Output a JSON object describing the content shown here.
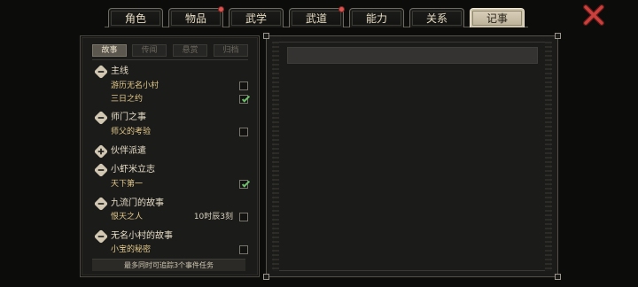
{
  "tabs": [
    {
      "label": "角色",
      "active": false,
      "badge": false
    },
    {
      "label": "物品",
      "active": false,
      "badge": true
    },
    {
      "label": "武学",
      "active": false,
      "badge": false
    },
    {
      "label": "武道",
      "active": false,
      "badge": true
    },
    {
      "label": "能力",
      "active": false,
      "badge": false
    },
    {
      "label": "关系",
      "active": false,
      "badge": false
    },
    {
      "label": "记事",
      "active": true,
      "badge": false
    }
  ],
  "close_icon": "close-x-icon",
  "subtabs": [
    {
      "label": "故事",
      "active": true
    },
    {
      "label": "传闻",
      "active": false
    },
    {
      "label": "悬赏",
      "active": false
    },
    {
      "label": "归档",
      "active": false
    }
  ],
  "sections": [
    {
      "title": "主线",
      "expanded": true,
      "quests": [
        {
          "name": "游历无名小村",
          "time": "",
          "checked": false
        },
        {
          "name": "三日之约",
          "time": "",
          "checked": true
        }
      ]
    },
    {
      "title": "师门之事",
      "expanded": true,
      "quests": [
        {
          "name": "师父的考验",
          "time": "",
          "checked": false
        }
      ]
    },
    {
      "title": "伙伴派遣",
      "expanded": false,
      "quests": []
    },
    {
      "title": "小虾米立志",
      "expanded": true,
      "quests": [
        {
          "name": "天下第一",
          "time": "",
          "checked": true
        }
      ]
    },
    {
      "title": "九流门的故事",
      "expanded": true,
      "quests": [
        {
          "name": "恨天之人",
          "time": "10时辰3刻",
          "checked": false
        }
      ]
    },
    {
      "title": "无名小村的故事",
      "expanded": true,
      "quests": [
        {
          "name": "小宝的秘密",
          "time": "",
          "checked": false
        }
      ]
    }
  ],
  "footer_note": "最多同时可追踪3个事件任务",
  "colors": {
    "accent_gold": "#e3c98a",
    "check_green": "#6cc16a",
    "badge_red": "#d9534f",
    "close_red": "#c9403c"
  }
}
